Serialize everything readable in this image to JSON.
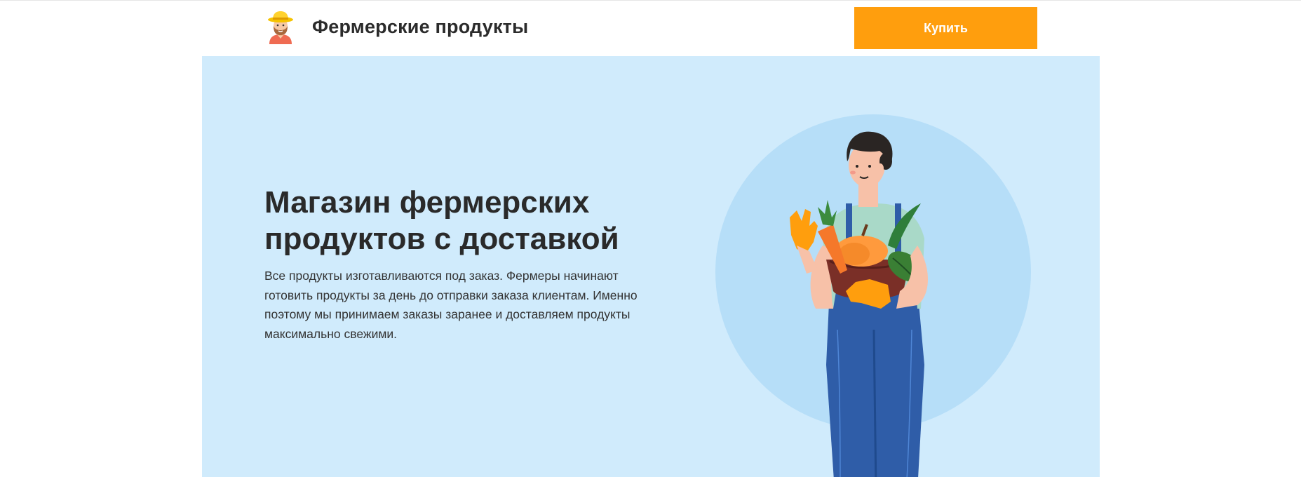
{
  "header": {
    "brand": "Фермерские продукты",
    "buy_label": "Купить",
    "logo_icon": "farmer-avatar-icon"
  },
  "hero": {
    "title": "Магазин фермерских продуктов с доставкой",
    "description": "Все продукты изготавливаются под заказ. Фермеры начинают готовить продукты за день до отправки заказа клиентам. Именно поэтому мы принимаем заказы заранее и доставляем продукты максимально свежими.",
    "illustration": "farmer-with-vegetable-basket-illustration"
  },
  "colors": {
    "accent": "#ff9e0d",
    "hero_background": "#d0ebfc",
    "text_dark": "#2a2a2a"
  }
}
